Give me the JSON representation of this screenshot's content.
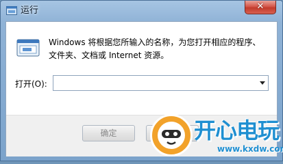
{
  "window": {
    "title": "运行",
    "close_glyph": "✕",
    "title_icon": "run-app-icon"
  },
  "dialog": {
    "icon": "run-dialog-icon",
    "message": "Windows 将根据您所输入的名称，为您打开相应的程序、文件夹、文档或 Internet 资源。",
    "open_label": "打开(O):",
    "open_value": ""
  },
  "buttons": {
    "ok_label": "确定",
    "cancel_label": ""
  },
  "watermark": {
    "brand": "开心电玩",
    "url": "www.kxdw.com"
  },
  "colors": {
    "title_bar": "#8fb2d6",
    "close_button": "#c23b2c",
    "watermark_blue": "#1f8fd1",
    "watermark_orange": "#f2a22a"
  }
}
